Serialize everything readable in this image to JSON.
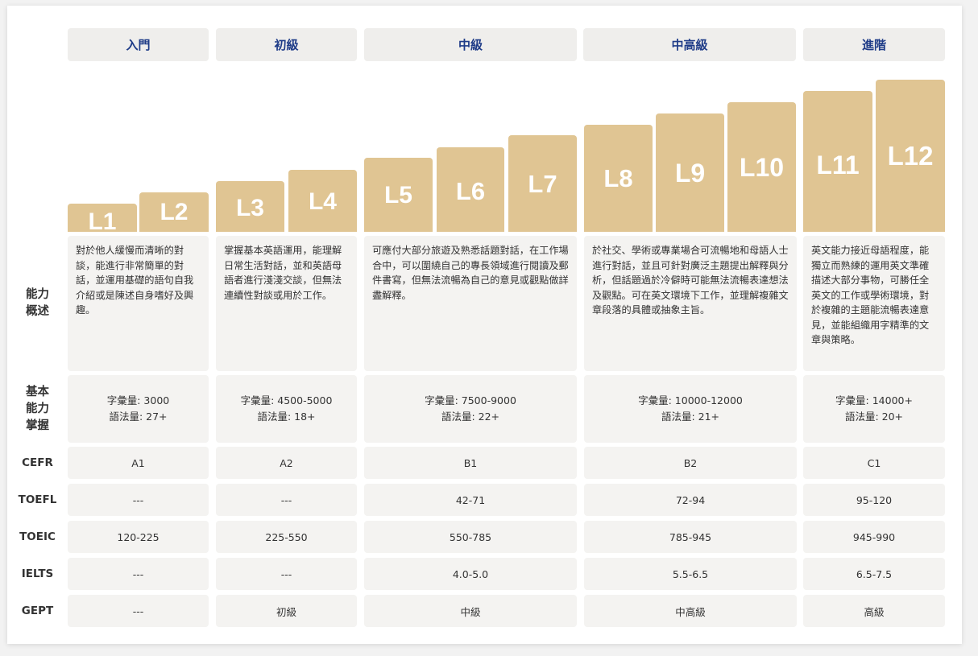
{
  "columns": [
    "入門",
    "初級",
    "中級",
    "中高級",
    "進階"
  ],
  "levels": [
    "L1",
    "L2",
    "L3",
    "L4",
    "L5",
    "L6",
    "L7",
    "L8",
    "L9",
    "L10",
    "L11",
    "L12"
  ],
  "row_labels": {
    "ability": [
      "能力",
      "概述"
    ],
    "basic": [
      "基本",
      "能力",
      "掌握"
    ],
    "cefr": "CEFR",
    "toefl": "TOEFL",
    "toeic": "TOEIC",
    "ielts": "IELTS",
    "gept": "GEPT"
  },
  "descriptions": [
    "對於他人緩慢而清晰的對談，能進行非常簡單的對話，並運用基礎的語句自我介紹或是陳述自身嗜好及興趣。",
    "掌握基本英語運用，能理解日常生活對話，並和英語母語者進行淺淺交談，但無法連續性對談或用於工作。",
    "可應付大部分旅遊及熟悉話題對話，在工作場合中，可以圍繞自己的專長領域進行閱讀及郵件書寫，但無法流暢為自己的意見或觀點做詳盡解釋。",
    "於社交、學術或專業場合可流暢地和母語人士進行對話，並且可針對廣泛主題提出解釋與分析，但話題過於冷僻時可能無法流暢表達想法及觀點。可在英文環境下工作，並理解複雜文章段落的具體或抽象主旨。",
    "英文能力接近母語程度，能獨立而熟練的運用英文準確描述大部分事物，可勝任全英文的工作或學術環境，對於複雜的主題能流暢表達意見，並能組織用字精準的文章與策略。"
  ],
  "basic": [
    {
      "vocab": "字彙量: 3000",
      "grammar": "語法量: 27+"
    },
    {
      "vocab": "字彙量: 4500-5000",
      "grammar": "語法量: 18+"
    },
    {
      "vocab": "字彙量: 7500-9000",
      "grammar": "語法量: 22+"
    },
    {
      "vocab": "字彙量: 10000-12000",
      "grammar": "語法量: 21+"
    },
    {
      "vocab": "字彙量: 14000+",
      "grammar": "語法量: 20+"
    }
  ],
  "cefr": [
    "A1",
    "A2",
    "B1",
    "B2",
    "C1"
  ],
  "toefl": [
    "---",
    "---",
    "42-71",
    "72-94",
    "95-120"
  ],
  "toeic": [
    "120-225",
    "225-550",
    "550-785",
    "785-945",
    "945-990"
  ],
  "ielts": [
    "---",
    "---",
    "4.0-5.0",
    "5.5-6.5",
    "6.5-7.5"
  ],
  "gept": [
    "---",
    "初級",
    "中級",
    "中高級",
    "高級"
  ],
  "colors": {
    "header_text": "#1f3c88",
    "bar": "#e0c593",
    "cell_bg": "#f4f3f1",
    "header_bg": "#efeeec"
  }
}
